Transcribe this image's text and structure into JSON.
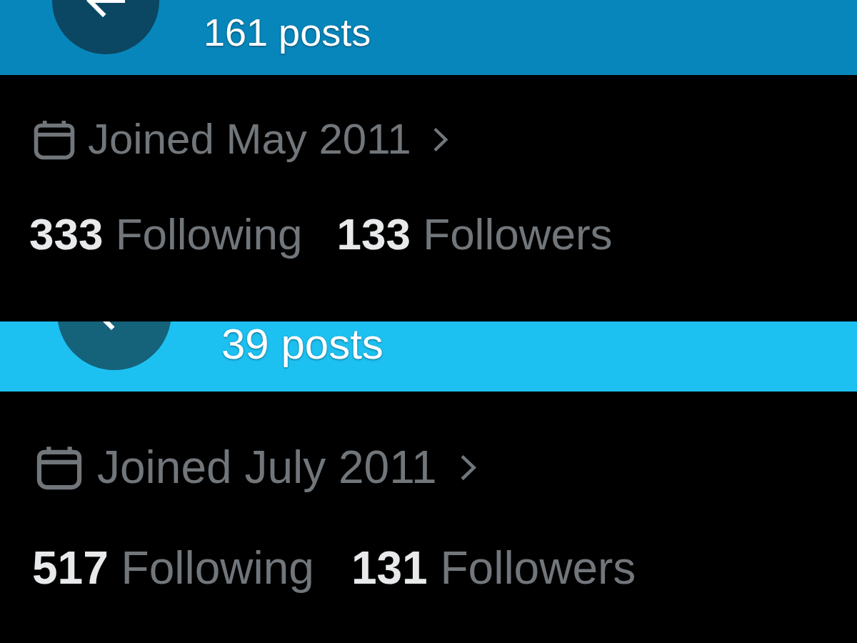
{
  "profiles": [
    {
      "header": {
        "color": "#0786bb",
        "posts": "161 posts"
      },
      "joined": "Joined May 2011",
      "following": "**333** Following",
      "followers": "**133** Followers"
    },
    {
      "header": {
        "color": "#1dc1f1",
        "posts": "39 posts"
      },
      "joined": "Joined July 2011",
      "following": "**517** Following",
      "followers": "**131** Followers"
    }
  ]
}
